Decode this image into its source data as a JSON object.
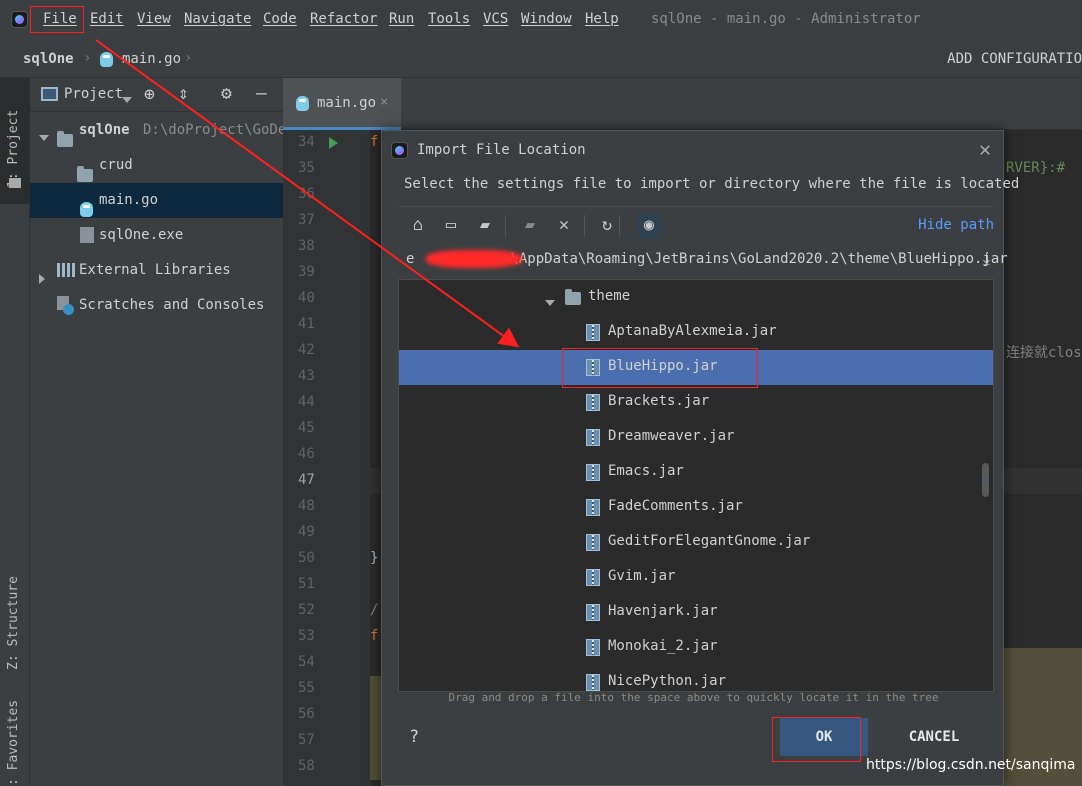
{
  "menu": {
    "items": [
      "File",
      "Edit",
      "View",
      "Navigate",
      "Code",
      "Refactor",
      "Run",
      "Tools",
      "VCS",
      "Window",
      "Help"
    ],
    "title": "sqlOne - main.go - Administrator"
  },
  "breadcrumb": {
    "project": "sqlOne",
    "file": "main.go",
    "add_configuration": "ADD CONFIGURATIO"
  },
  "left_stripe": {
    "project_tab": "1: Project",
    "structure_tab": "Z: Structure",
    "favorites_tab": ": Favorites"
  },
  "project_panel": {
    "view_label": "Project",
    "tree": [
      {
        "label": "sqlOne",
        "path": "D:\\doProject\\GoDe",
        "type": "root"
      },
      {
        "label": "crud",
        "type": "folder"
      },
      {
        "label": "main.go",
        "type": "go",
        "selected": true
      },
      {
        "label": "sqlOne.exe",
        "type": "exe"
      },
      {
        "label": "External Libraries",
        "type": "libs"
      },
      {
        "label": "Scratches and Consoles",
        "type": "scratches"
      }
    ]
  },
  "editor": {
    "tab_label": "main.go",
    "line_numbers": [
      "34",
      "35",
      "36",
      "37",
      "38",
      "39",
      "40",
      "41",
      "42",
      "43",
      "44",
      "45",
      "46",
      "47",
      "48",
      "49",
      "50",
      "51",
      "52",
      "53",
      "54",
      "55",
      "56",
      "57",
      "58"
    ],
    "code_fragments": {
      "line34": "f",
      "line35_right": "RVER}:#",
      "line42_right": "连接就clos",
      "line50": "}",
      "line52": "/.",
      "line53": "f",
      "line58": ");"
    }
  },
  "dialog": {
    "title": "Import File Location",
    "description": "Select the settings file to import or directory where the file is located",
    "hide_path": "Hide path",
    "path_prefix": "e",
    "path_suffix": "\\AppData\\Roaming\\JetBrains\\GoLand2020.2\\theme\\BlueHippo.jar",
    "toolbar_icons": [
      "home-icon",
      "desktop-icon",
      "project-folder-icon",
      "new-folder-icon",
      "delete-icon",
      "refresh-icon",
      "show-hidden-icon"
    ],
    "tree": {
      "folder": "theme",
      "files": [
        "AptanaByAlexmeia.jar",
        "BlueHippo.jar",
        "Brackets.jar",
        "Dreamweaver.jar",
        "Emacs.jar",
        "FadeComments.jar",
        "GeditForElegantGnome.jar",
        "Gvim.jar",
        "Havenjark.jar",
        "Monokai_2.jar",
        "NicePython.jar"
      ],
      "selected": "BlueHippo.jar"
    },
    "drag_hint": "Drag and drop a file into the space above to quickly locate it in the tree",
    "help": "?",
    "ok": "OK",
    "cancel": "CANCEL"
  },
  "watermark": "https://blog.csdn.net/sanqima",
  "colors": {
    "selection": "#4b6eaf",
    "annotation": "#ff2020",
    "link": "#589df6",
    "ok_button": "#365880"
  }
}
